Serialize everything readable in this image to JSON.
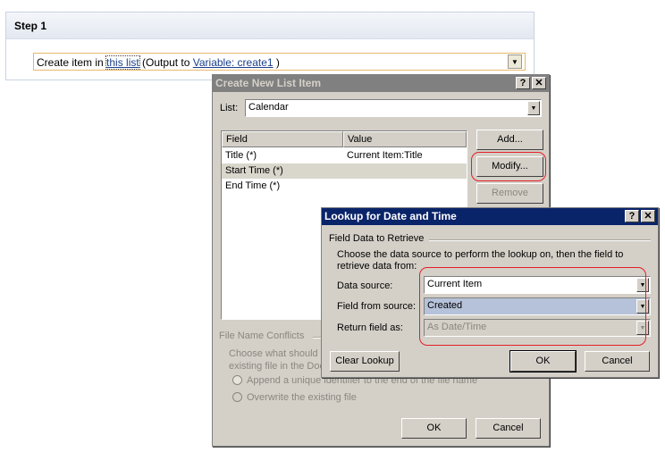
{
  "step": {
    "title": "Step 1",
    "action_prefix": "Create item in ",
    "list_link": "this list",
    "output_text": " (Output to ",
    "variable_link": "Variable: create1",
    "close_paren": " )"
  },
  "create_dialog": {
    "title": "Create New List Item",
    "help_label": "?",
    "close_label": "✕",
    "list_label": "List:",
    "list_value": "Calendar",
    "columns": [
      "Field",
      "Value"
    ],
    "rows": [
      {
        "field": "Title (*)",
        "value": "Current Item:Title"
      },
      {
        "field": "Start Time (*)",
        "value": ""
      },
      {
        "field": "End Time (*)",
        "value": ""
      }
    ],
    "add_label": "Add...",
    "modify_label": "Modify...",
    "remove_label": "Remove",
    "conflicts_label": "File Name Conflicts",
    "conflicts_desc_1": "Choose what should h",
    "conflicts_desc_2": "existing file in the Doc",
    "option_append": "Append a unique identifier to the end of the file name",
    "option_overwrite": "Overwrite the existing file",
    "ok_label": "OK",
    "cancel_label": "Cancel"
  },
  "lookup_dialog": {
    "title": "Lookup for Date and Time",
    "help_label": "?",
    "close_label": "✕",
    "group_label": "Field Data to Retrieve",
    "description": "Choose the data source to perform the lookup on, then the field to retrieve data from:",
    "data_source_label": "Data source:",
    "data_source_value": "Current Item",
    "field_source_label": "Field from source:",
    "field_source_value": "Created",
    "return_label": "Return field as:",
    "return_value": "As Date/Time",
    "clear_label": "Clear Lookup",
    "ok_label": "OK",
    "cancel_label": "Cancel"
  },
  "icons": {
    "dropdown": "▼"
  },
  "colors": {
    "highlight_ring": "#e41e26",
    "active_title": "#0a246a",
    "inactive_title": "#808080",
    "link": "#1b3f8c"
  }
}
